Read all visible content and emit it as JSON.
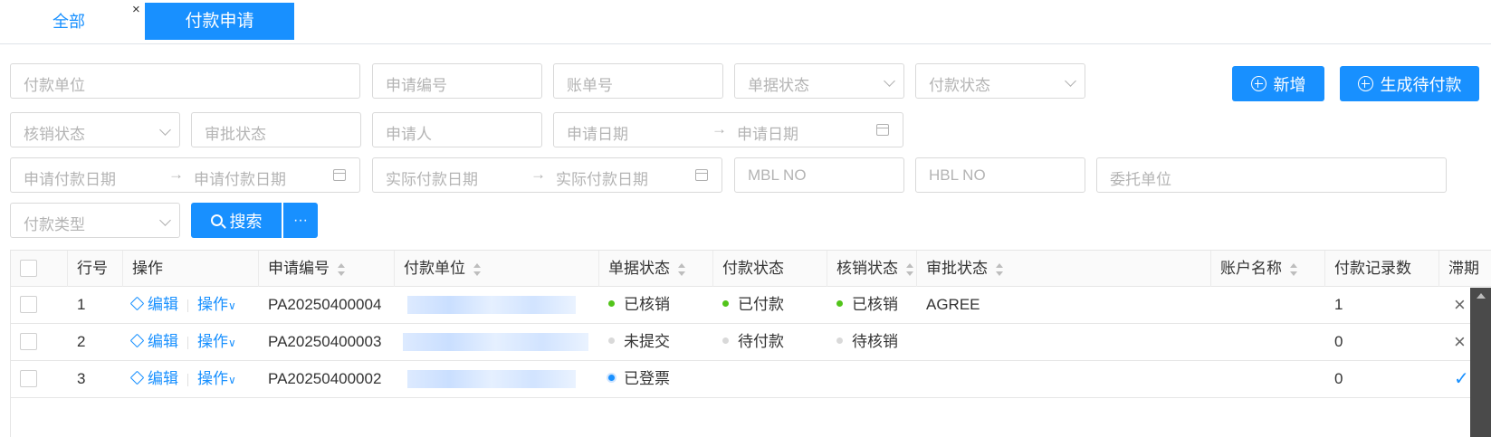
{
  "tabs": {
    "all": "全部",
    "close": "×",
    "active": "付款申请"
  },
  "filters": {
    "payee_unit": "付款单位",
    "apply_no": "申请编号",
    "bill_no": "账单号",
    "doc_status": "单据状态",
    "pay_status": "付款状态",
    "writeoff_status": "核销状态",
    "approval_status": "审批状态",
    "applicant": "申请人",
    "apply_date_start": "申请日期",
    "apply_date_end": "申请日期",
    "req_pay_date_start": "申请付款日期",
    "req_pay_date_end": "申请付款日期",
    "actual_pay_date_start": "实际付款日期",
    "actual_pay_date_end": "实际付款日期",
    "mbl_no": "MBL NO",
    "hbl_no": "HBL NO",
    "consignor": "委托单位",
    "pay_type": "付款类型",
    "range_arrow": "→"
  },
  "buttons": {
    "add": "新增",
    "generate": "生成待付款",
    "search": "搜索",
    "more": "···"
  },
  "table": {
    "headers": {
      "row_no": "行号",
      "actions": "操作",
      "apply_no": "申请编号",
      "payee_unit": "付款单位",
      "doc_status": "单据状态",
      "pay_status": "付款状态",
      "writeoff_status": "核销状态",
      "approval_status": "审批状态",
      "account_name": "账户名称",
      "pay_record_count": "付款记录数",
      "overdue": "滞期"
    },
    "edit_label": "编辑",
    "ops_label": "操作",
    "rows": [
      {
        "row_no": "1",
        "apply_no": "PA20250400004",
        "doc_status": "已核销",
        "pay_status": "已付款",
        "writeoff_status": "已核销",
        "approval_status": "AGREE",
        "pay_record_count": "1",
        "overdue": "×"
      },
      {
        "row_no": "2",
        "apply_no": "PA20250400003",
        "doc_status": "未提交",
        "pay_status": "待付款",
        "writeoff_status": "待核销",
        "approval_status": "",
        "pay_record_count": "0",
        "overdue": "×"
      },
      {
        "row_no": "3",
        "apply_no": "PA20250400002",
        "doc_status": "已登票",
        "pay_status": "",
        "writeoff_status": "",
        "approval_status": "",
        "pay_record_count": "0",
        "overdue": "✓"
      }
    ]
  },
  "colors": {
    "accent": "#1890ff",
    "green": "#52c41a",
    "grey": "#d0d0d0"
  }
}
